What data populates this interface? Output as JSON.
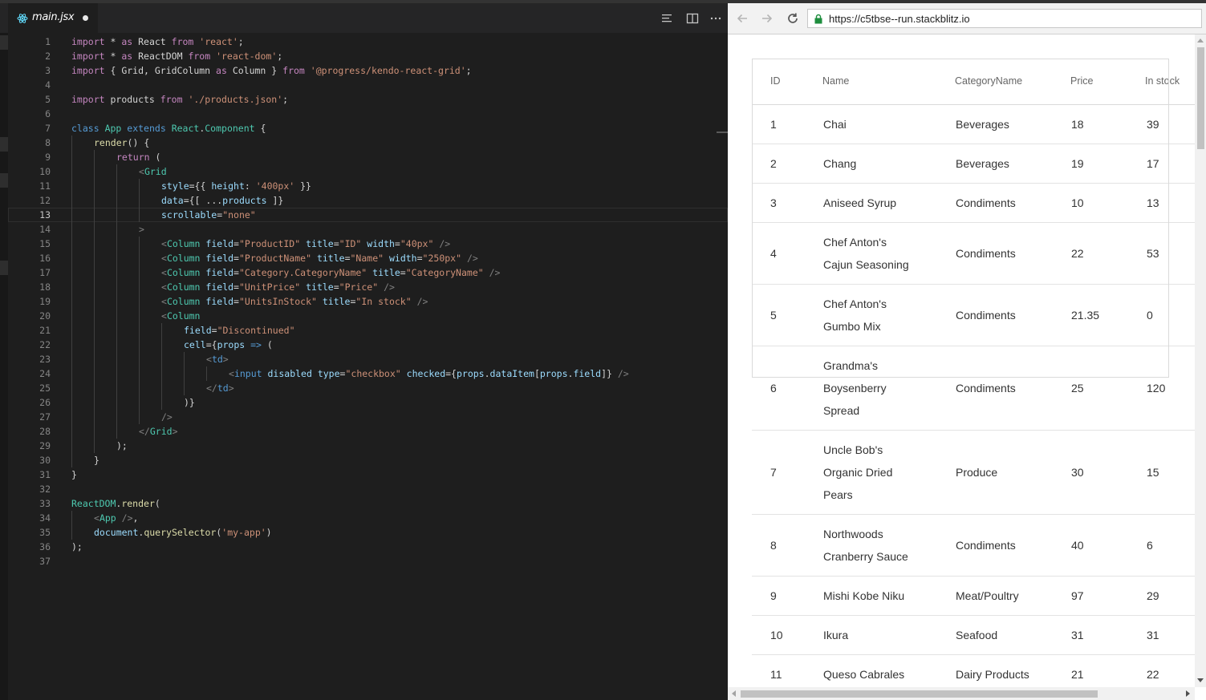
{
  "editor": {
    "tab": {
      "filename": "main.jsx"
    },
    "lines": [
      {
        "n": "1",
        "indent": 0,
        "cur": false,
        "tokens": [
          [
            "kp",
            "import"
          ],
          [
            "p",
            " * "
          ],
          [
            "kp",
            "as"
          ],
          [
            "p",
            " React "
          ],
          [
            "kp",
            "from"
          ],
          [
            "p",
            " "
          ],
          [
            "s",
            "'react'"
          ],
          [
            "p",
            ";"
          ]
        ]
      },
      {
        "n": "2",
        "indent": 0,
        "cur": false,
        "tokens": [
          [
            "kp",
            "import"
          ],
          [
            "p",
            " * "
          ],
          [
            "kp",
            "as"
          ],
          [
            "p",
            " ReactDOM "
          ],
          [
            "kp",
            "from"
          ],
          [
            "p",
            " "
          ],
          [
            "s",
            "'react-dom'"
          ],
          [
            "p",
            ";"
          ]
        ]
      },
      {
        "n": "3",
        "indent": 0,
        "cur": false,
        "tokens": [
          [
            "kp",
            "import"
          ],
          [
            "p",
            " { Grid, GridColumn "
          ],
          [
            "kp",
            "as"
          ],
          [
            "p",
            " Column } "
          ],
          [
            "kp",
            "from"
          ],
          [
            "p",
            " "
          ],
          [
            "s",
            "'@progress/kendo-react-grid'"
          ],
          [
            "p",
            ";"
          ]
        ]
      },
      {
        "n": "4",
        "indent": 0,
        "cur": false,
        "tokens": []
      },
      {
        "n": "5",
        "indent": 0,
        "cur": false,
        "tokens": [
          [
            "kp",
            "import"
          ],
          [
            "p",
            " products "
          ],
          [
            "kp",
            "from"
          ],
          [
            "p",
            " "
          ],
          [
            "s",
            "'./products.json'"
          ],
          [
            "p",
            ";"
          ]
        ]
      },
      {
        "n": "6",
        "indent": 0,
        "cur": false,
        "tokens": []
      },
      {
        "n": "7",
        "indent": 0,
        "cur": false,
        "tokens": [
          [
            "k",
            "class"
          ],
          [
            "p",
            " "
          ],
          [
            "c",
            "App"
          ],
          [
            "p",
            " "
          ],
          [
            "k",
            "extends"
          ],
          [
            "p",
            " "
          ],
          [
            "c",
            "React"
          ],
          [
            "p",
            "."
          ],
          [
            "c",
            "Component"
          ],
          [
            "p",
            " {"
          ]
        ]
      },
      {
        "n": "8",
        "indent": 1,
        "cur": false,
        "tokens": [
          [
            "f",
            "render"
          ],
          [
            "p",
            "() {"
          ]
        ]
      },
      {
        "n": "9",
        "indent": 2,
        "cur": false,
        "tokens": [
          [
            "kp",
            "return"
          ],
          [
            "p",
            " ("
          ]
        ]
      },
      {
        "n": "10",
        "indent": 3,
        "cur": false,
        "tokens": [
          [
            "g",
            "<"
          ],
          [
            "c",
            "Grid"
          ]
        ]
      },
      {
        "n": "11",
        "indent": 4,
        "cur": false,
        "tokens": [
          [
            "a",
            "style"
          ],
          [
            "p",
            "={{ "
          ],
          [
            "v",
            "height"
          ],
          [
            "p",
            ": "
          ],
          [
            "s",
            "'400px'"
          ],
          [
            "p",
            " }}"
          ]
        ]
      },
      {
        "n": "12",
        "indent": 4,
        "cur": false,
        "tokens": [
          [
            "a",
            "data"
          ],
          [
            "p",
            "={[ ..."
          ],
          [
            "v",
            "products"
          ],
          [
            "p",
            " ]}"
          ]
        ]
      },
      {
        "n": "13",
        "indent": 4,
        "cur": true,
        "tokens": [
          [
            "a",
            "scrollable"
          ],
          [
            "p",
            "="
          ],
          [
            "s",
            "\"none\""
          ]
        ]
      },
      {
        "n": "14",
        "indent": 3,
        "cur": false,
        "tokens": [
          [
            "g",
            ">"
          ]
        ]
      },
      {
        "n": "15",
        "indent": 4,
        "cur": false,
        "tokens": [
          [
            "g",
            "<"
          ],
          [
            "c",
            "Column"
          ],
          [
            "p",
            " "
          ],
          [
            "a",
            "field"
          ],
          [
            "p",
            "="
          ],
          [
            "s",
            "\"ProductID\""
          ],
          [
            "p",
            " "
          ],
          [
            "a",
            "title"
          ],
          [
            "p",
            "="
          ],
          [
            "s",
            "\"ID\""
          ],
          [
            "p",
            " "
          ],
          [
            "a",
            "width"
          ],
          [
            "p",
            "="
          ],
          [
            "s",
            "\"40px\""
          ],
          [
            "p",
            " "
          ],
          [
            "g",
            "/>"
          ]
        ]
      },
      {
        "n": "16",
        "indent": 4,
        "cur": false,
        "tokens": [
          [
            "g",
            "<"
          ],
          [
            "c",
            "Column"
          ],
          [
            "p",
            " "
          ],
          [
            "a",
            "field"
          ],
          [
            "p",
            "="
          ],
          [
            "s",
            "\"ProductName\""
          ],
          [
            "p",
            " "
          ],
          [
            "a",
            "title"
          ],
          [
            "p",
            "="
          ],
          [
            "s",
            "\"Name\""
          ],
          [
            "p",
            " "
          ],
          [
            "a",
            "width"
          ],
          [
            "p",
            "="
          ],
          [
            "s",
            "\"250px\""
          ],
          [
            "p",
            " "
          ],
          [
            "g",
            "/>"
          ]
        ]
      },
      {
        "n": "17",
        "indent": 4,
        "cur": false,
        "tokens": [
          [
            "g",
            "<"
          ],
          [
            "c",
            "Column"
          ],
          [
            "p",
            " "
          ],
          [
            "a",
            "field"
          ],
          [
            "p",
            "="
          ],
          [
            "s",
            "\"Category.CategoryName\""
          ],
          [
            "p",
            " "
          ],
          [
            "a",
            "title"
          ],
          [
            "p",
            "="
          ],
          [
            "s",
            "\"CategoryName\""
          ],
          [
            "p",
            " "
          ],
          [
            "g",
            "/>"
          ]
        ]
      },
      {
        "n": "18",
        "indent": 4,
        "cur": false,
        "tokens": [
          [
            "g",
            "<"
          ],
          [
            "c",
            "Column"
          ],
          [
            "p",
            " "
          ],
          [
            "a",
            "field"
          ],
          [
            "p",
            "="
          ],
          [
            "s",
            "\"UnitPrice\""
          ],
          [
            "p",
            " "
          ],
          [
            "a",
            "title"
          ],
          [
            "p",
            "="
          ],
          [
            "s",
            "\"Price\""
          ],
          [
            "p",
            " "
          ],
          [
            "g",
            "/>"
          ]
        ]
      },
      {
        "n": "19",
        "indent": 4,
        "cur": false,
        "tokens": [
          [
            "g",
            "<"
          ],
          [
            "c",
            "Column"
          ],
          [
            "p",
            " "
          ],
          [
            "a",
            "field"
          ],
          [
            "p",
            "="
          ],
          [
            "s",
            "\"UnitsInStock\""
          ],
          [
            "p",
            " "
          ],
          [
            "a",
            "title"
          ],
          [
            "p",
            "="
          ],
          [
            "s",
            "\"In stock\""
          ],
          [
            "p",
            " "
          ],
          [
            "g",
            "/>"
          ]
        ]
      },
      {
        "n": "20",
        "indent": 4,
        "cur": false,
        "tokens": [
          [
            "g",
            "<"
          ],
          [
            "c",
            "Column"
          ]
        ]
      },
      {
        "n": "21",
        "indent": 5,
        "cur": false,
        "tokens": [
          [
            "a",
            "field"
          ],
          [
            "p",
            "="
          ],
          [
            "s",
            "\"Discontinued\""
          ]
        ]
      },
      {
        "n": "22",
        "indent": 5,
        "cur": false,
        "tokens": [
          [
            "a",
            "cell"
          ],
          [
            "p",
            "={"
          ],
          [
            "v",
            "props"
          ],
          [
            "p",
            " "
          ],
          [
            "k",
            "=>"
          ],
          [
            "p",
            " ("
          ]
        ]
      },
      {
        "n": "23",
        "indent": 6,
        "cur": false,
        "tokens": [
          [
            "g",
            "<"
          ],
          [
            "t",
            "td"
          ],
          [
            "g",
            ">"
          ]
        ]
      },
      {
        "n": "24",
        "indent": 7,
        "cur": false,
        "tokens": [
          [
            "g",
            "<"
          ],
          [
            "t",
            "input"
          ],
          [
            "p",
            " "
          ],
          [
            "a",
            "disabled"
          ],
          [
            "p",
            " "
          ],
          [
            "a",
            "type"
          ],
          [
            "p",
            "="
          ],
          [
            "s",
            "\"checkbox\""
          ],
          [
            "p",
            " "
          ],
          [
            "a",
            "checked"
          ],
          [
            "p",
            "={"
          ],
          [
            "v",
            "props"
          ],
          [
            "p",
            "."
          ],
          [
            "v",
            "dataItem"
          ],
          [
            "p",
            "["
          ],
          [
            "v",
            "props"
          ],
          [
            "p",
            "."
          ],
          [
            "v",
            "field"
          ],
          [
            "p",
            "]} "
          ],
          [
            "g",
            "/>"
          ]
        ]
      },
      {
        "n": "25",
        "indent": 6,
        "cur": false,
        "tokens": [
          [
            "g",
            "</"
          ],
          [
            "t",
            "td"
          ],
          [
            "g",
            ">"
          ]
        ]
      },
      {
        "n": "26",
        "indent": 5,
        "cur": false,
        "tokens": [
          [
            "p",
            ")}"
          ]
        ]
      },
      {
        "n": "27",
        "indent": 4,
        "cur": false,
        "tokens": [
          [
            "g",
            "/>"
          ]
        ]
      },
      {
        "n": "28",
        "indent": 3,
        "cur": false,
        "tokens": [
          [
            "g",
            "</"
          ],
          [
            "c",
            "Grid"
          ],
          [
            "g",
            ">"
          ]
        ]
      },
      {
        "n": "29",
        "indent": 2,
        "cur": false,
        "tokens": [
          [
            "p",
            ");"
          ]
        ]
      },
      {
        "n": "30",
        "indent": 1,
        "cur": false,
        "tokens": [
          [
            "p",
            "}"
          ]
        ]
      },
      {
        "n": "31",
        "indent": 0,
        "cur": false,
        "tokens": [
          [
            "p",
            "}"
          ]
        ]
      },
      {
        "n": "32",
        "indent": 0,
        "cur": false,
        "tokens": []
      },
      {
        "n": "33",
        "indent": 0,
        "cur": false,
        "tokens": [
          [
            "c",
            "ReactDOM"
          ],
          [
            "p",
            "."
          ],
          [
            "f",
            "render"
          ],
          [
            "p",
            "("
          ]
        ]
      },
      {
        "n": "34",
        "indent": 1,
        "cur": false,
        "tokens": [
          [
            "g",
            "<"
          ],
          [
            "c",
            "App"
          ],
          [
            "p",
            " "
          ],
          [
            "g",
            "/>"
          ],
          [
            "p",
            ","
          ]
        ]
      },
      {
        "n": "35",
        "indent": 1,
        "cur": false,
        "tokens": [
          [
            "v",
            "document"
          ],
          [
            "p",
            "."
          ],
          [
            "f",
            "querySelector"
          ],
          [
            "p",
            "("
          ],
          [
            "s",
            "'my-app'"
          ],
          [
            "p",
            ")"
          ]
        ]
      },
      {
        "n": "36",
        "indent": 0,
        "cur": false,
        "tokens": [
          [
            "p",
            ");"
          ]
        ]
      },
      {
        "n": "37",
        "indent": 0,
        "cur": false,
        "tokens": []
      }
    ]
  },
  "browser": {
    "url": "https://c5tbse--run.stackblitz.io",
    "grid": {
      "headers": {
        "id": "ID",
        "name": "Name",
        "category": "CategoryName",
        "price": "Price",
        "stock": "In stock"
      },
      "rows": [
        {
          "id": "1",
          "name": [
            "Chai"
          ],
          "category": "Beverages",
          "price": "18",
          "stock": "39"
        },
        {
          "id": "2",
          "name": [
            "Chang"
          ],
          "category": "Beverages",
          "price": "19",
          "stock": "17"
        },
        {
          "id": "3",
          "name": [
            "Aniseed Syrup"
          ],
          "category": "Condiments",
          "price": "10",
          "stock": "13"
        },
        {
          "id": "4",
          "name": [
            "Chef Anton's",
            "Cajun Seasoning"
          ],
          "category": "Condiments",
          "price": "22",
          "stock": "53"
        },
        {
          "id": "5",
          "name": [
            "Chef Anton's",
            "Gumbo Mix"
          ],
          "category": "Condiments",
          "price": "21.35",
          "stock": "0"
        },
        {
          "id": "6",
          "name": [
            "Grandma's",
            "Boysenberry",
            "Spread"
          ],
          "category": "Condiments",
          "price": "25",
          "stock": "120"
        },
        {
          "id": "7",
          "name": [
            "Uncle Bob's",
            "Organic Dried",
            "Pears"
          ],
          "category": "Produce",
          "price": "30",
          "stock": "15"
        },
        {
          "id": "8",
          "name": [
            "Northwoods",
            "Cranberry Sauce"
          ],
          "category": "Condiments",
          "price": "40",
          "stock": "6"
        },
        {
          "id": "9",
          "name": [
            "Mishi Kobe Niku"
          ],
          "category": "Meat/Poultry",
          "price": "97",
          "stock": "29"
        },
        {
          "id": "10",
          "name": [
            "Ikura"
          ],
          "category": "Seafood",
          "price": "31",
          "stock": "31"
        },
        {
          "id": "11",
          "name": [
            "Queso Cabrales"
          ],
          "category": "Dairy Products",
          "price": "21",
          "stock": "22"
        }
      ]
    }
  }
}
